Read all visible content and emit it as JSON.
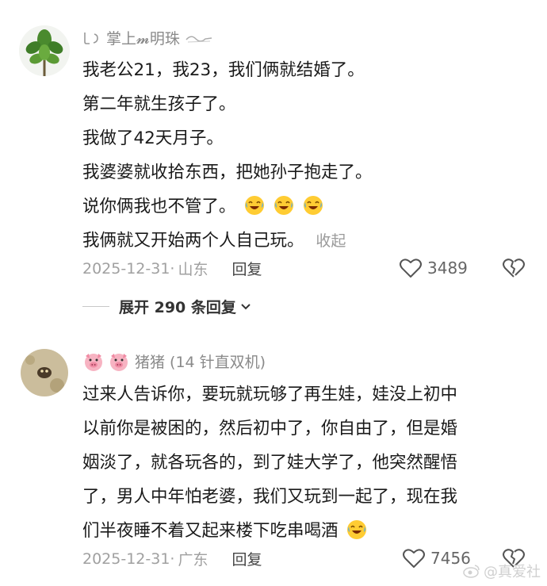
{
  "comments": [
    {
      "username": "掌上𝓶明珠",
      "lines": [
        "我老公21，我23，我们俩就结婚了。",
        "第二年就生孩子了。",
        "我做了42天月子。",
        "我婆婆就收拾东西，把她孙子抱走了。",
        "说你俩我也不管了。",
        "我俩就又开始两个人自己玩。"
      ],
      "collapse_label": "收起",
      "date": "2025-12-31",
      "location": "山东",
      "reply_label": "回复",
      "likes": "3489",
      "expand_replies": "展开 290 条回复"
    },
    {
      "username": "猪猪 (14 针直双机)",
      "lines": [
        "过来人告诉你，要玩就玩够了再生娃，娃没上初中",
        "以前你是被困的，然后初中了，你自由了，但是婚",
        "姻淡了，就各玩各的，到了娃大学了，他突然醒悟",
        "了，男人中年怕老婆，我们又玩到一起了，现在我",
        "们半夜睡不着又起来楼下吃串喝酒"
      ],
      "date": "2025-12-31",
      "location": "广东",
      "reply_label": "回复",
      "likes": "7456"
    }
  ],
  "watermark": "@真爱社",
  "icons": [
    "slash-brackets-icon",
    "wave-icon",
    "pig-emoji-icon",
    "laugh-cry-emoji-icon",
    "heart-outline-icon",
    "broken-heart-icon",
    "chevron-down-icon"
  ]
}
